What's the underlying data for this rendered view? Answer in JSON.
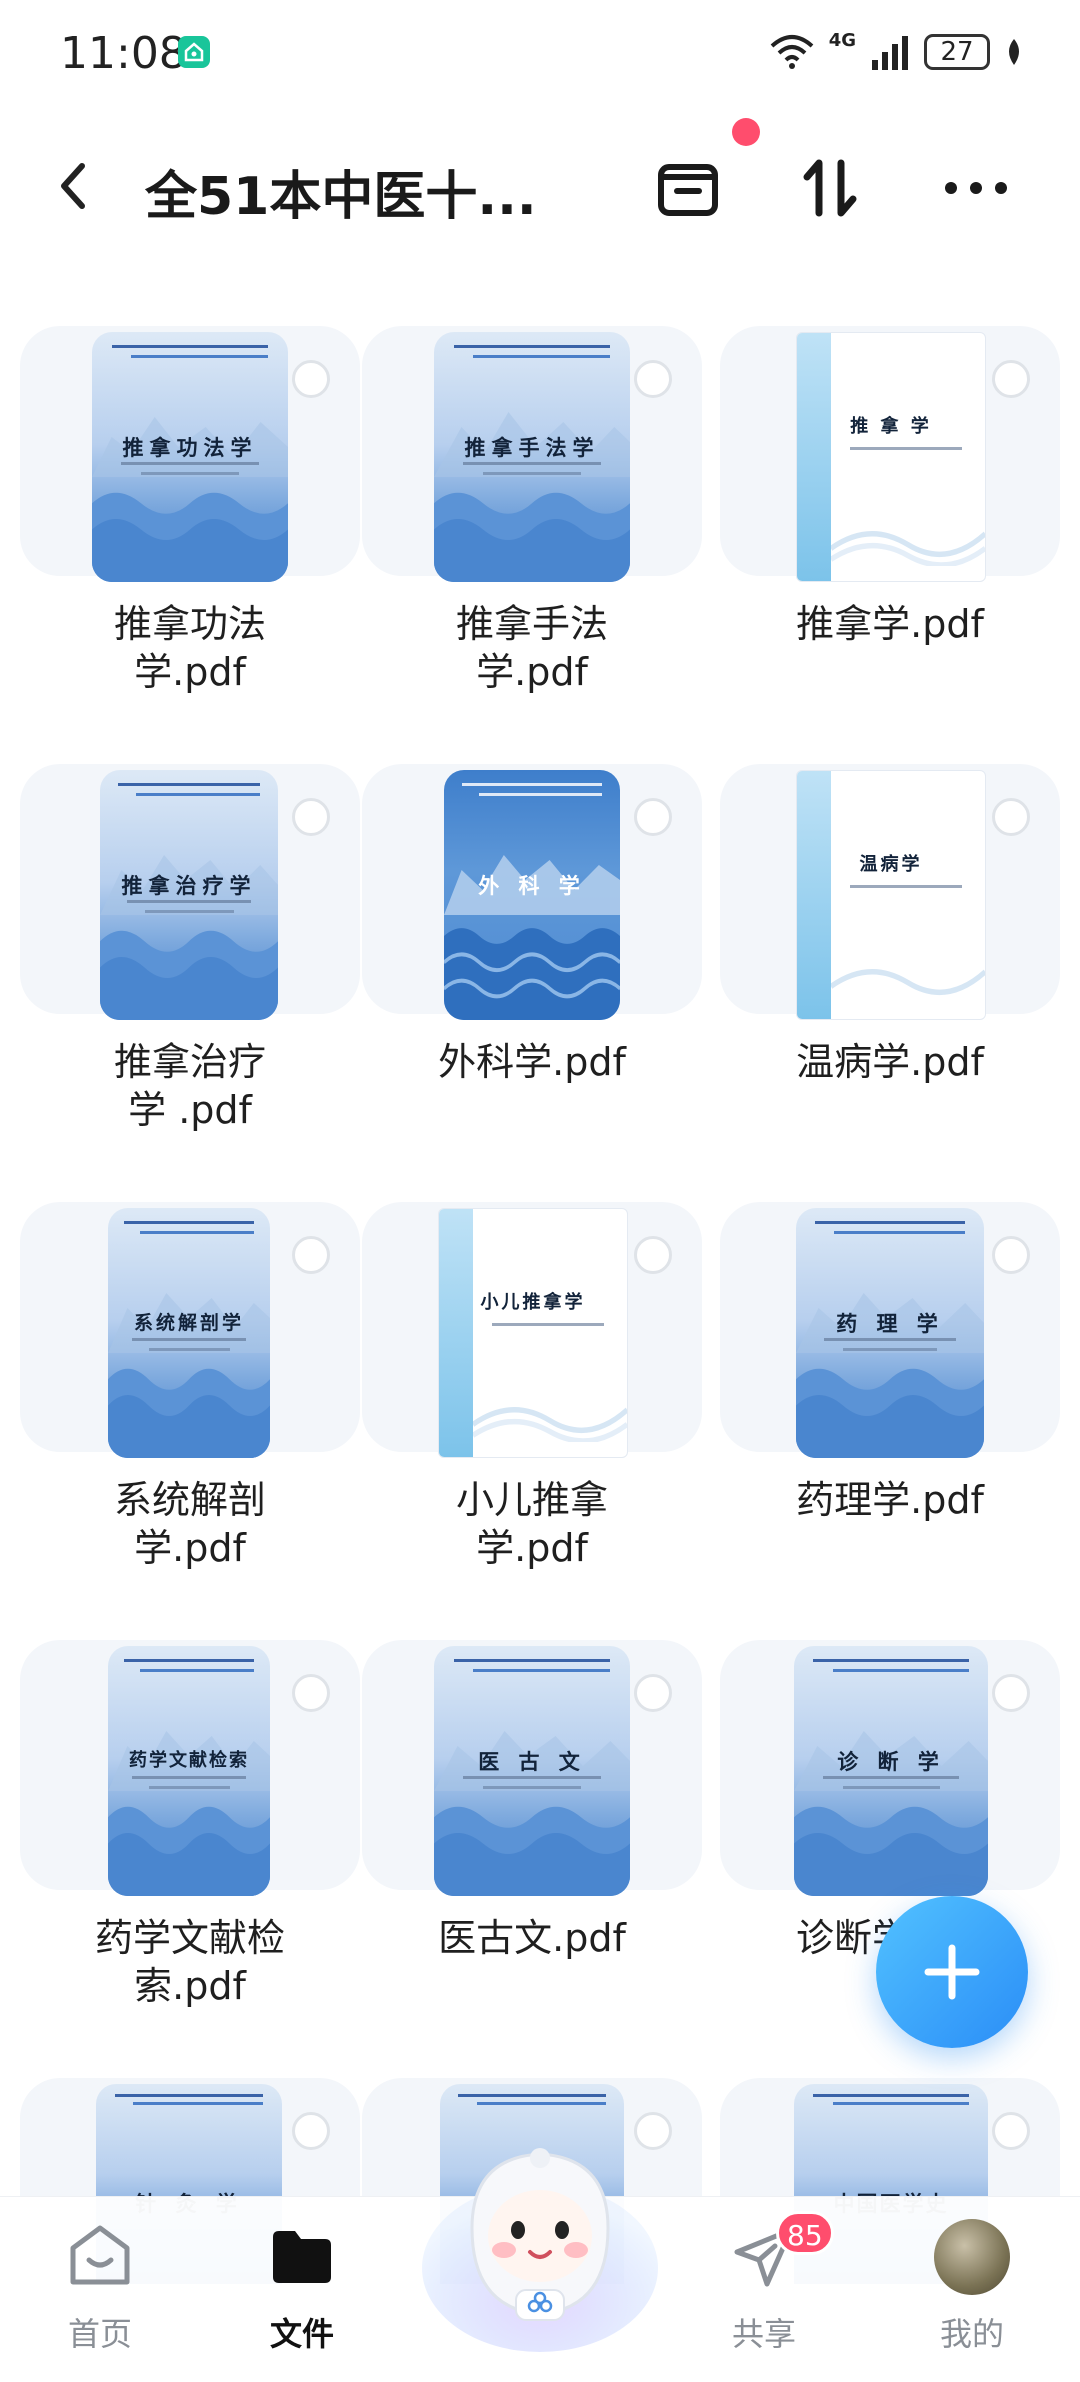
{
  "status_bar": {
    "time": "11:08",
    "network": "4G",
    "battery": "27"
  },
  "header": {
    "title": "全51本中医十..."
  },
  "files": [
    {
      "name": "推拿功法学.pdf",
      "cover_title": "推拿功法学",
      "cover_style": "blue"
    },
    {
      "name": "推拿手法学.pdf",
      "cover_title": "推拿手法学",
      "cover_style": "blue"
    },
    {
      "name": "推拿学.pdf",
      "cover_title": "推 拿 学",
      "cover_style": "white"
    },
    {
      "name": "推拿治疗学 .pdf",
      "cover_title": "推拿治疗学",
      "cover_style": "blue"
    },
    {
      "name": "外科学.pdf",
      "cover_title": "外 科 学",
      "cover_style": "blue"
    },
    {
      "name": "温病学.pdf",
      "cover_title": "温病学",
      "cover_style": "white"
    },
    {
      "name": "系统解剖学.pdf",
      "cover_title": "系统解剖学",
      "cover_style": "blue"
    },
    {
      "name": "小儿推拿学.pdf",
      "cover_title": "小儿推拿学",
      "cover_style": "white"
    },
    {
      "name": "药理学.pdf",
      "cover_title": "药 理 学",
      "cover_style": "blue"
    },
    {
      "name": "药学文献检索.pdf",
      "cover_title": "药学文献检索",
      "cover_style": "blue"
    },
    {
      "name": "医古文.pdf",
      "cover_title": "医 古 文",
      "cover_style": "blue"
    },
    {
      "name": "诊断学.pdf",
      "cover_title": "诊 断 学",
      "cover_style": "blue"
    },
    {
      "name": "",
      "cover_title": "针 灸 学",
      "cover_style": "blue"
    },
    {
      "name": "",
      "cover_title": "",
      "cover_style": "blue"
    },
    {
      "name": "",
      "cover_title": "中国医学史",
      "cover_style": "blue"
    }
  ],
  "file_name_lines": [
    [
      "推拿功法",
      "学.pdf"
    ],
    [
      "推拿手法",
      "学.pdf"
    ],
    [
      "推拿学.pdf"
    ],
    [
      "推拿治疗",
      "学 .pdf"
    ],
    [
      "外科学.pdf"
    ],
    [
      "温病学.pdf"
    ],
    [
      "系统解剖",
      "学.pdf"
    ],
    [
      "小儿推拿",
      "学.pdf"
    ],
    [
      "药理学.pdf"
    ],
    [
      "药学文献检",
      "索.pdf"
    ],
    [
      "医古文.pdf"
    ],
    [
      "诊断学.pdf"
    ]
  ],
  "bottom_nav": {
    "home": "首页",
    "files": "文件",
    "share": "共享",
    "share_badge": "85",
    "mine": "我的"
  },
  "colors": {
    "accent": "#2a8df7",
    "badge": "#ff4d6d",
    "cover_blue": "#4a86cf"
  }
}
